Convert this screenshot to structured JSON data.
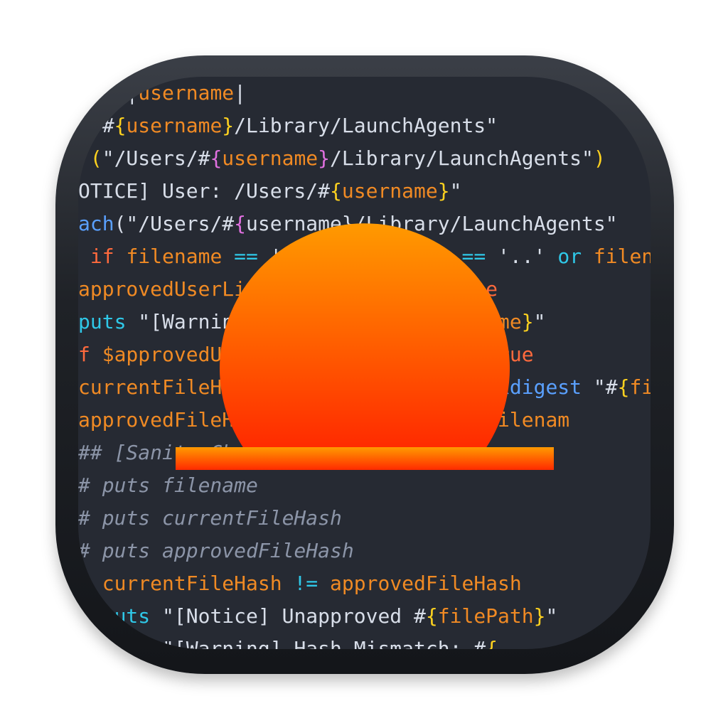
{
  "code_lines": [
    [
      {
        "t": "    |",
        "c": "c-str"
      },
      {
        "t": "username",
        "c": "c-var"
      },
      {
        "t": "|",
        "c": "c-str"
      }
    ],
    [
      {
        "t": "s/#",
        "c": "c-str"
      },
      {
        "t": "{",
        "c": "c-brace"
      },
      {
        "t": "username",
        "c": "c-var"
      },
      {
        "t": "}",
        "c": "c-brace"
      },
      {
        "t": "/Library/LaunchAgents\"",
        "c": "c-str"
      }
    ],
    [
      {
        "t": " (",
        "c": "c-brace"
      },
      {
        "t": "\"/Users/#",
        "c": "c-str"
      },
      {
        "t": "{",
        "c": "c-brace-p"
      },
      {
        "t": "username",
        "c": "c-var"
      },
      {
        "t": "}",
        "c": "c-brace-p"
      },
      {
        "t": "/Library/LaunchAgents\"",
        "c": "c-str"
      },
      {
        "t": ")",
        "c": "c-brace"
      }
    ],
    [
      {
        "t": "OTICE] User: /Users/#",
        "c": "c-str"
      },
      {
        "t": "{",
        "c": "c-brace"
      },
      {
        "t": "username",
        "c": "c-var"
      },
      {
        "t": "}",
        "c": "c-brace"
      },
      {
        "t": "\"",
        "c": "c-str"
      }
    ],
    [
      {
        "t": "ach",
        "c": "c-method"
      },
      {
        "t": "(\"/Users/#",
        "c": "c-str"
      },
      {
        "t": "{",
        "c": "c-brace-p"
      },
      {
        "t": "username}/Library/LaunchAgents\"",
        "c": "c-str"
      }
    ],
    [
      {
        "t": " if ",
        "c": "c-kw"
      },
      {
        "t": "filename",
        "c": "c-var"
      },
      {
        "t": " == ",
        "c": "c-op"
      },
      {
        "t": "'.'",
        "c": "c-str"
      },
      {
        "t": " or filename ",
        "c": "c-var"
      },
      {
        "t": "==",
        "c": "c-op"
      },
      {
        "t": " '..'",
        "c": "c-str"
      },
      {
        "t": " or ",
        "c": "c-op"
      },
      {
        "t": "filen",
        "c": "c-var"
      }
    ],
    [
      {
        "t": "approvedUserList[filename]",
        "c": "c-var"
      },
      {
        "t": " == ",
        "c": "c-op"
      },
      {
        "t": "false",
        "c": "c-kw"
      }
    ],
    [
      {
        "t": "puts",
        "c": "c-op"
      },
      {
        "t": " \"[Warning] Unapproved #",
        "c": "c-str"
      },
      {
        "t": "{",
        "c": "c-brace"
      },
      {
        "t": "filename",
        "c": "c-var"
      },
      {
        "t": "}",
        "c": "c-brace"
      },
      {
        "t": "\"",
        "c": "c-str"
      }
    ],
    [
      {
        "t": "f ",
        "c": "c-kw"
      },
      {
        "t": "$approvedUserList[filename]",
        "c": "c-var"
      },
      {
        "t": ")",
        "c": "c-brace"
      },
      {
        "t": " == ",
        "c": "c-op"
      },
      {
        "t": "true",
        "c": "c-kw"
      }
    ],
    [
      {
        "t": "currentFileHash = Digest::SHA256.",
        "c": "c-var"
      },
      {
        "t": "hexdigest",
        "c": "c-method"
      },
      {
        "t": " \"#",
        "c": "c-str"
      },
      {
        "t": "{",
        "c": "c-brace"
      },
      {
        "t": "fil",
        "c": "c-var"
      }
    ],
    [
      {
        "t": "approvedFileHash = approvedLaunch",
        "c": "c-var"
      },
      {
        "t": "[",
        "c": "c-brace"
      },
      {
        "t": "filenam",
        "c": "c-var"
      }
    ],
    [
      {
        "t": "## [Sanity Check]",
        "c": "c-com"
      }
    ],
    [
      {
        "t": "# puts filename",
        "c": "c-com"
      }
    ],
    [
      {
        "t": "# puts currentFileHash",
        "c": "c-com"
      }
    ],
    [
      {
        "t": "# puts approvedFileHash",
        "c": "c-com"
      }
    ],
    [
      {
        "t": "f ",
        "c": "c-kw"
      },
      {
        "t": "currentFileHash",
        "c": "c-var"
      },
      {
        "t": " != ",
        "c": "c-op"
      },
      {
        "t": "approvedFileHash",
        "c": "c-var"
      }
    ],
    [
      {
        "t": "  puts",
        "c": "c-op"
      },
      {
        "t": " \"[Notice] Unapproved #",
        "c": "c-str"
      },
      {
        "t": "{",
        "c": "c-brace"
      },
      {
        "t": "filePath",
        "c": "c-var"
      },
      {
        "t": "}",
        "c": "c-brace"
      },
      {
        "t": "\"",
        "c": "c-str"
      }
    ],
    [
      {
        "t": "  puts",
        "c": "c-op"
      },
      {
        "t": " \"[Warning] Hash Mismatch: #",
        "c": "c-str"
      },
      {
        "t": "{",
        "c": "c-brace"
      }
    ]
  ],
  "colors": {
    "sun_top": "#ff9a00",
    "sun_bottom": "#ff2a00",
    "tile_bg": "#262a33"
  }
}
